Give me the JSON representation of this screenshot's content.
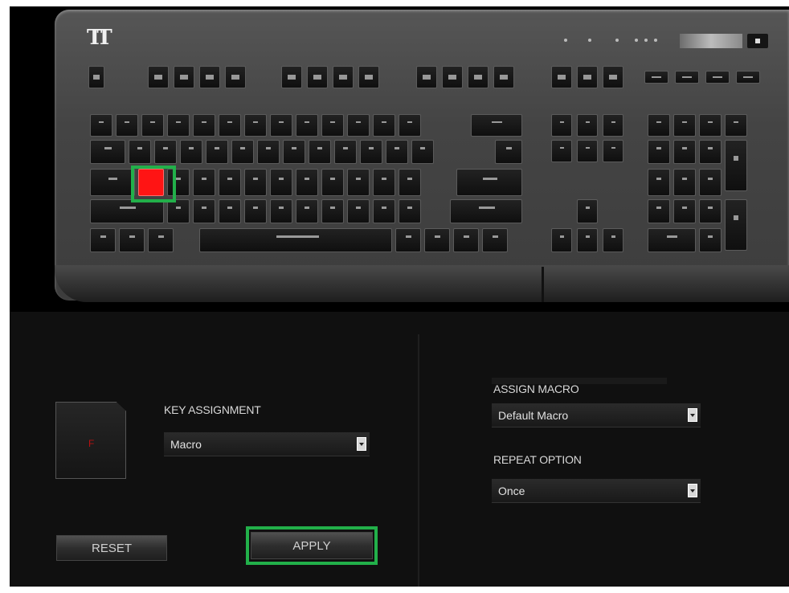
{
  "keyboard": {
    "brand_logo": "TT",
    "selected_key": "F",
    "highlight_color": "#22b04a",
    "selected_key_color": "#ff1414"
  },
  "config": {
    "key_assignment_label": "KEY ASSIGNMENT",
    "key_assignment_value": "Macro",
    "assign_macro_label": "ASSIGN MACRO",
    "assign_macro_value": "Default Macro",
    "repeat_option_label": "REPEAT OPTION",
    "repeat_option_value": "Once"
  },
  "buttons": {
    "reset": "RESET",
    "apply": "APPLY"
  }
}
